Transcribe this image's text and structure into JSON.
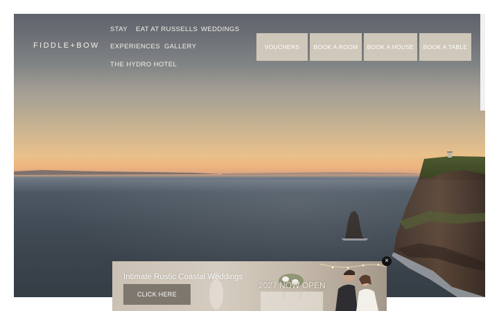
{
  "site": {
    "logo": "FIDDLE+BOW"
  },
  "nav": {
    "items": [
      {
        "label": "STAY"
      },
      {
        "label": "EAT AT RUSSELLS"
      },
      {
        "label": "WEDDINGS"
      },
      {
        "label": "EXPERIENCES"
      },
      {
        "label": "GALLERY"
      },
      {
        "label": "THE HYDRO HOTEL"
      }
    ]
  },
  "cta": {
    "buttons": [
      {
        "label": "VOUCHERS"
      },
      {
        "label": "BOOK A ROOM"
      },
      {
        "label": "BOOK A HOUSE"
      },
      {
        "label": "BOOK A TABLE"
      }
    ]
  },
  "banner": {
    "title": "Intimate Rustic Coastal Weddings",
    "button_label": "CLICK HERE",
    "year_text": "2027 NOW OPEN",
    "close_glyph": "×"
  },
  "colors": {
    "cta_background": "#d6cdbe",
    "banner_button": "#7d776e",
    "nav_text": "#f4f1ea"
  }
}
